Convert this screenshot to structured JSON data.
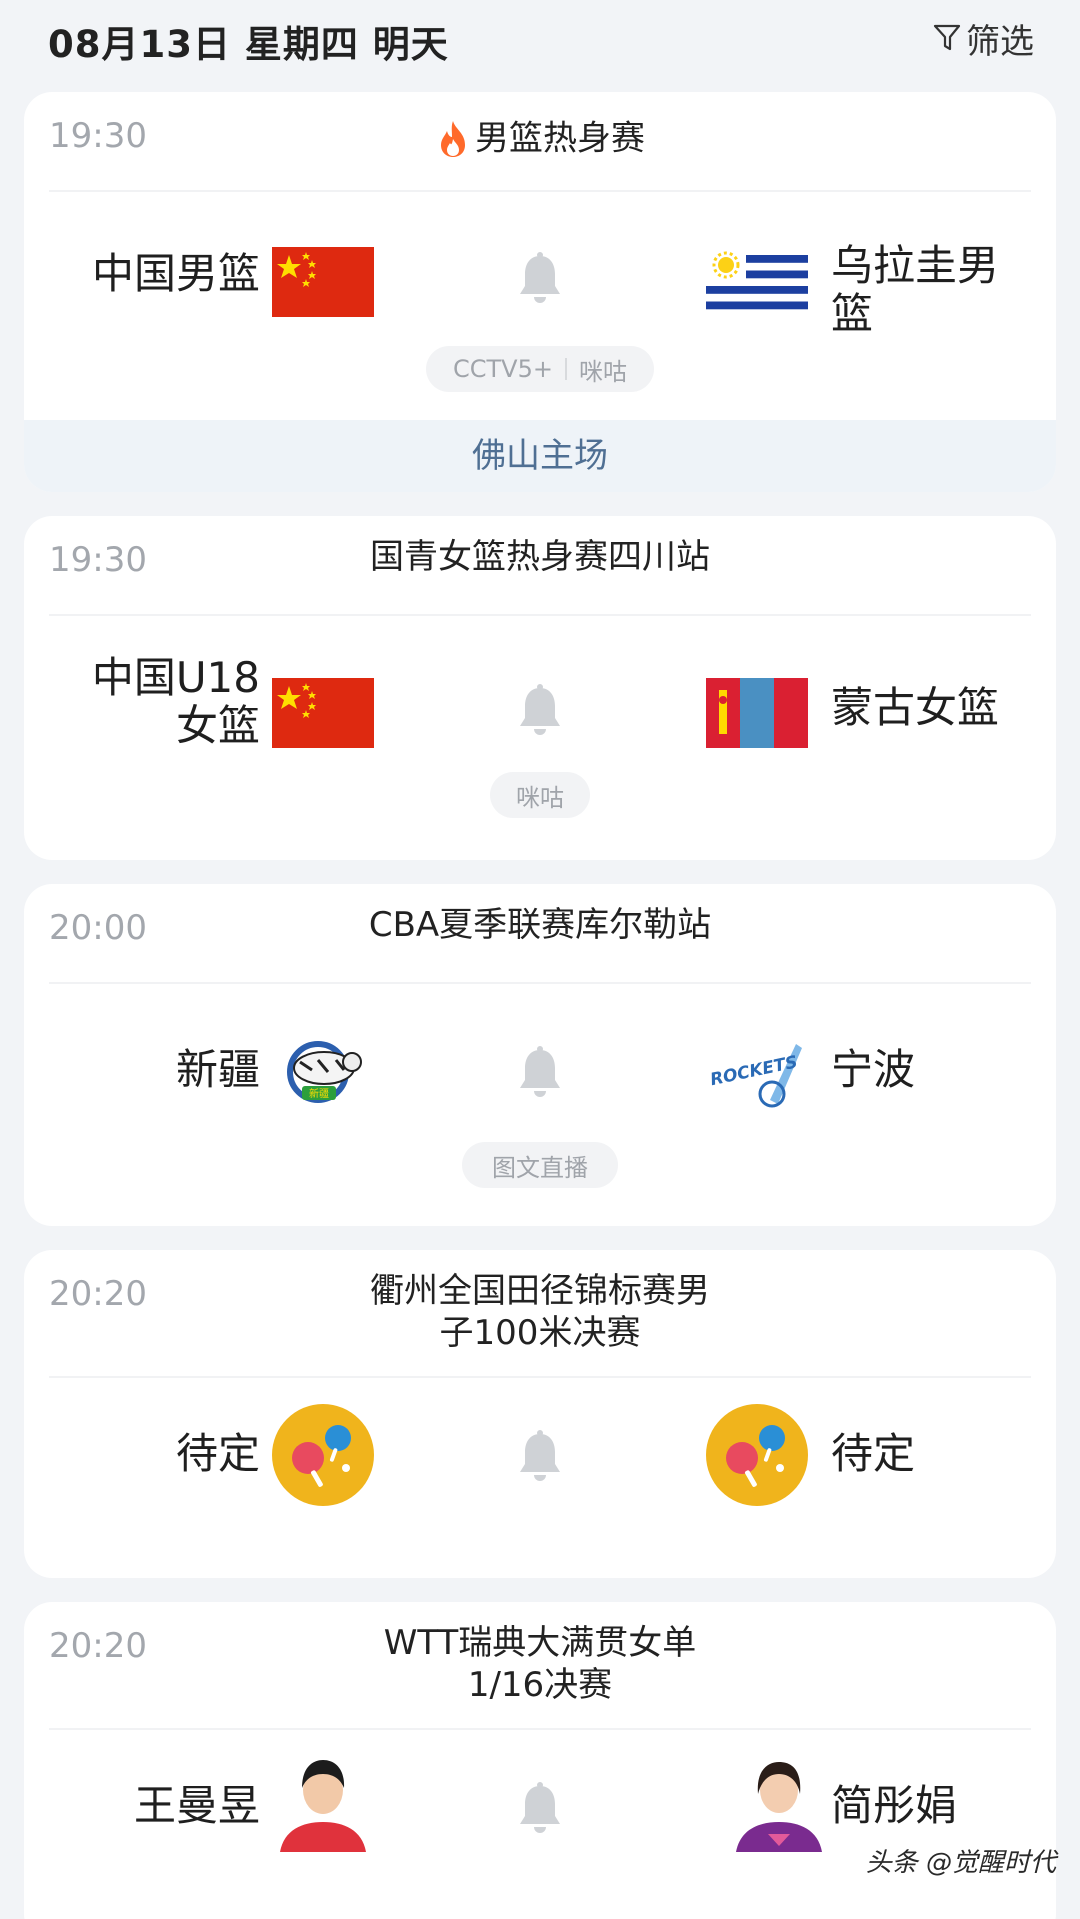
{
  "header": {
    "date_title": "08月13日 星期四 明天",
    "filter_label": "筛选"
  },
  "matches": [
    {
      "time": "19:30",
      "title": "男篮热身赛",
      "hot": true,
      "left_team": "中国男篮",
      "right_team": "乌拉圭男篮",
      "left_logo": "china-flag",
      "right_logo": "uruguay-flag",
      "channels": [
        "CCTV5+",
        "咪咕"
      ],
      "venue": "佛山主场"
    },
    {
      "time": "19:30",
      "title": "国青女篮热身赛四川站",
      "left_team": "中国U18女篮",
      "right_team": "蒙古女篮",
      "left_logo": "china-flag",
      "right_logo": "mongolia-flag",
      "channels": [
        "咪咕"
      ]
    },
    {
      "time": "20:00",
      "title": "CBA夏季联赛库尔勒站",
      "left_team": "新疆",
      "right_team": "宁波",
      "left_logo": "xinjiang-tigers-logo",
      "right_logo": "ningbo-rockets-logo",
      "left_logo_text": "新疆",
      "right_logo_text": "ROCKETS",
      "channels": [
        "图文直播"
      ]
    },
    {
      "time": "20:20",
      "title": "衢州全国田径锦标赛男子100米决赛",
      "left_team": "待定",
      "right_team": "待定",
      "left_logo": "table-tennis-placeholder-icon",
      "right_logo": "table-tennis-placeholder-icon"
    },
    {
      "time": "20:20",
      "title": "WTT瑞典大满贯女单1/16决赛",
      "left_team": "王曼昱",
      "right_team": "简彤娟",
      "left_logo": "player-avatar",
      "right_logo": "player-avatar"
    }
  ],
  "watermark": "头条 @觉醒时代",
  "colors": {
    "background": "#f2f4f7",
    "card": "#ffffff",
    "time_text": "#a3a7ad",
    "venue_text": "#4f6f93",
    "venue_bg": "#eef3f8",
    "china_red": "#de2910",
    "star_yellow": "#ffde00",
    "hot_orange": "#ff6a2b"
  }
}
